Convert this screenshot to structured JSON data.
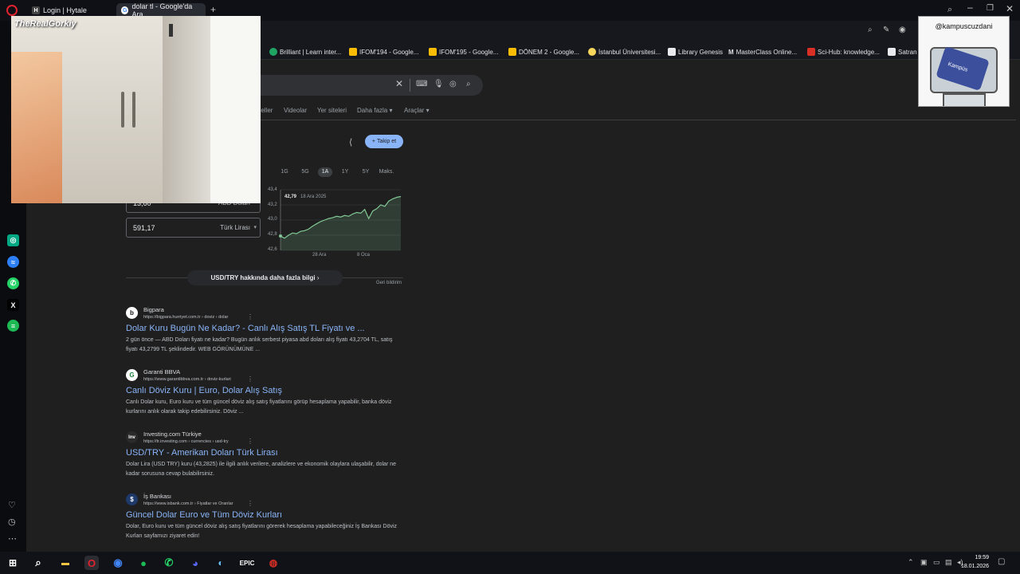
{
  "tabs": [
    {
      "label": "Login | Hytale",
      "icon": "hytale-icon"
    },
    {
      "label": "dolar tl - Google'da Ara",
      "icon": "google-icon"
    }
  ],
  "bookmarks": [
    {
      "label": "Brilliant | Learn inter...",
      "color": "#1fa463"
    },
    {
      "label": "IFOM'194 - Google...",
      "color": "#fbbc04"
    },
    {
      "label": "IFOM'195 - Google...",
      "color": "#fbbc04"
    },
    {
      "label": "DÖNEM 2 - Google...",
      "color": "#fbbc04"
    },
    {
      "label": "İstanbul Üniversitesi...",
      "color": "#f6d55c"
    },
    {
      "label": "Library Genesis",
      "color": "#e8eaed"
    },
    {
      "label": "MasterClass Online...",
      "color": "#e8eaed"
    },
    {
      "label": "Sci-Hub: knowledge...",
      "color": "#d93025"
    },
    {
      "label": "Satran",
      "color": "#e8eaed"
    }
  ],
  "filters": [
    "Görseller",
    "Videolar",
    "Yer siteleri",
    "Daha fazla",
    "Araçlar"
  ],
  "finance": {
    "follow_label": "Takip et",
    "ranges": [
      "1G",
      "5G",
      "1A",
      "1Y",
      "5Y",
      "Maks."
    ],
    "tooltip_value": "42,79",
    "tooltip_date": "18 Ara 2025",
    "converter_from_value": "13,60",
    "converter_from_currency": "ABD Doları",
    "converter_to_value": "591,17",
    "converter_to_currency": "Türk Lirası",
    "more_label": "USD/TRY hakkında daha fazla bilgi",
    "feedback_label": "Geri bildirim"
  },
  "chart_data": {
    "type": "line",
    "title": "",
    "xlabel": "",
    "ylabel": "",
    "y_ticks": [
      "43,4",
      "43,2",
      "43,0",
      "42,8",
      "42,6"
    ],
    "x_ticks": [
      "28 Ara",
      "8 Oca"
    ],
    "ylim": [
      42.6,
      43.4
    ],
    "x": [
      0,
      1,
      2,
      3,
      4,
      5,
      6,
      7,
      8,
      9,
      10,
      11,
      12,
      13,
      14,
      15,
      16,
      17,
      18,
      19,
      20,
      21,
      22,
      23,
      24,
      25,
      26,
      27,
      28,
      29,
      30
    ],
    "values": [
      42.79,
      42.76,
      42.8,
      42.83,
      42.82,
      42.85,
      42.86,
      42.88,
      42.92,
      42.95,
      42.98,
      43.0,
      43.02,
      43.03,
      43.05,
      43.04,
      43.06,
      43.05,
      43.08,
      43.1,
      43.09,
      43.14,
      43.02,
      43.12,
      43.15,
      43.2,
      43.18,
      43.25,
      43.28,
      43.3,
      43.31
    ],
    "grid": true,
    "accent": "#81c995"
  },
  "results": [
    {
      "site": "Bigpara",
      "url": "https://bigpara.hurriyet.com.tr › doviz › dolar",
      "title": "Dolar Kuru Bugün Ne Kadar? - Canlı Alış Satış TL Fiyatı ve ...",
      "snippet": "2 gün önce — ABD Doları fiyatı ne kadar? Bugün anlık serbest piyasa abd doları alış fiyatı 43,2704 TL, satış fiyatı 43,2799 TL şeklindedir. WEB GÖRÜNÜMÜNE ...",
      "fav": "b",
      "favbg": "#ffffff",
      "favfg": "#111"
    },
    {
      "site": "Garanti BBVA",
      "url": "https://www.garantibbva.com.tr › doviz-kurlari",
      "title": "Canlı Döviz Kuru | Euro, Dolar Alış Satış",
      "snippet": "Canlı Dolar kuru, Euro kuru ve tüm güncel döviz alış satış fiyatlarını görüp hesaplama yapabilir, banka döviz kurlarını anlık olarak takip edebilirsiniz. Döviz ...",
      "fav": "G",
      "favbg": "#ffffff",
      "favfg": "#1a7f37"
    },
    {
      "site": "Investing.com Türkiye",
      "url": "https://tr.investing.com › currencies › usd-try",
      "title": "USD/TRY - Amerikan Doları Türk Lirası",
      "snippet": "Dolar Lira (USD TRY) kuru (43,2825) ile ilgili anlık verilere, analizlere ve ekonomik olaylara ulaşabilir, dolar ne kadar sorusuna cevap bulabilirsiniz.",
      "fav": "Inv",
      "favbg": "#2a2a2a",
      "favfg": "#ffffff"
    },
    {
      "site": "İş Bankası",
      "url": "https://www.isbank.com.tr › Fiyatlar ve Oranlar",
      "title": "Güncel Dolar Euro ve Tüm Döviz Kurları",
      "snippet": "Dolar, Euro kuru ve tüm güncel döviz alış satış fiyatlarını görerek hesaplama yapabileceğiniz İş Bankası Döviz Kurları sayfamızı ziyaret edin!",
      "fav": "$",
      "favbg": "#1d3a6b",
      "favfg": "#ffffff"
    }
  ],
  "overlay": {
    "webcam_name": "TheRealGorkiy",
    "badge_handle": "@kampuscuzdani",
    "badge_logo_text": "Kampüs"
  },
  "taskbar": {
    "time": "19:59",
    "date": "18.01.2026"
  }
}
